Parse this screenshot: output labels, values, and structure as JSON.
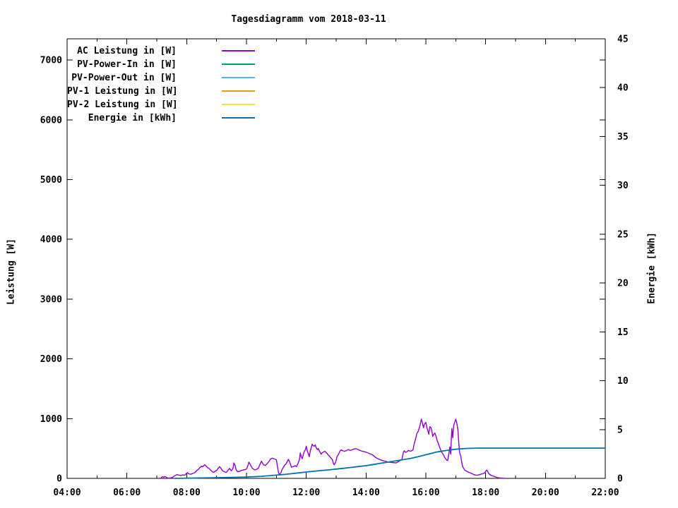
{
  "title": "Tagesdiagramm vom 2018-03-11",
  "chart_data": {
    "type": "line",
    "title": "Tagesdiagramm vom 2018-03-11",
    "grid": false,
    "legend_position": "top-left-inside",
    "background_color": "#ffffff",
    "border_color": "#000000",
    "x_axis": {
      "label": "",
      "range_hours": [
        4,
        22
      ],
      "major_tick_hours": [
        4,
        6,
        8,
        10,
        12,
        14,
        16,
        18,
        20,
        22
      ],
      "major_tick_labels": [
        "04:00",
        "06:00",
        "08:00",
        "10:00",
        "12:00",
        "14:00",
        "16:00",
        "18:00",
        "20:00",
        "22:00"
      ],
      "minor_tick_hours": [
        5,
        7,
        9,
        11,
        13,
        15,
        17,
        19,
        21
      ]
    },
    "y_left": {
      "label": "Leistung [W]",
      "range": [
        0,
        7355
      ],
      "tick_values": [
        0,
        1000,
        2000,
        3000,
        4000,
        5000,
        6000,
        7000
      ],
      "tick_labels": [
        "0",
        "1000",
        "2000",
        "3000",
        "4000",
        "5000",
        "6000",
        "7000"
      ]
    },
    "y_right": {
      "label": "Energie [kWh]",
      "range": [
        0,
        45
      ],
      "tick_values": [
        0,
        5,
        10,
        15,
        20,
        25,
        30,
        35,
        40,
        45
      ],
      "tick_labels": [
        "0",
        "5",
        "10",
        "15",
        "20",
        "25",
        "30",
        "35",
        "40",
        "45"
      ]
    },
    "series": [
      {
        "name": "AC Leistung in [W]",
        "color": "#9400d3",
        "axis": "left",
        "stroke_width": 1.4,
        "points": [
          [
            7.13,
            0
          ],
          [
            7.17,
            22
          ],
          [
            7.2,
            30
          ],
          [
            7.23,
            18
          ],
          [
            7.27,
            32
          ],
          [
            7.3,
            25
          ],
          [
            7.33,
            12
          ],
          [
            7.4,
            4
          ],
          [
            7.47,
            8
          ],
          [
            7.53,
            18
          ],
          [
            7.6,
            45
          ],
          [
            7.67,
            62
          ],
          [
            7.73,
            55
          ],
          [
            7.8,
            48
          ],
          [
            7.87,
            58
          ],
          [
            7.93,
            52
          ],
          [
            8.0,
            85
          ],
          [
            8.03,
            95
          ],
          [
            8.07,
            75
          ],
          [
            8.13,
            68
          ],
          [
            8.2,
            82
          ],
          [
            8.27,
            95
          ],
          [
            8.33,
            130
          ],
          [
            8.4,
            155
          ],
          [
            8.43,
            175
          ],
          [
            8.47,
            190
          ],
          [
            8.5,
            205
          ],
          [
            8.53,
            192
          ],
          [
            8.57,
            210
          ],
          [
            8.6,
            228
          ],
          [
            8.63,
            215
          ],
          [
            8.67,
            195
          ],
          [
            8.7,
            178
          ],
          [
            8.75,
            165
          ],
          [
            8.8,
            140
          ],
          [
            8.85,
            112
          ],
          [
            8.9,
            100
          ],
          [
            8.95,
            118
          ],
          [
            9.0,
            132
          ],
          [
            9.05,
            165
          ],
          [
            9.1,
            195
          ],
          [
            9.13,
            178
          ],
          [
            9.17,
            150
          ],
          [
            9.2,
            128
          ],
          [
            9.27,
            108
          ],
          [
            9.33,
            102
          ],
          [
            9.4,
            145
          ],
          [
            9.43,
            168
          ],
          [
            9.47,
            140
          ],
          [
            9.5,
            128
          ],
          [
            9.55,
            172
          ],
          [
            9.58,
            258
          ],
          [
            9.62,
            215
          ],
          [
            9.65,
            148
          ],
          [
            9.7,
            112
          ],
          [
            9.77,
            118
          ],
          [
            9.83,
            132
          ],
          [
            9.9,
            142
          ],
          [
            9.97,
            148
          ],
          [
            10.0,
            158
          ],
          [
            10.05,
            215
          ],
          [
            10.08,
            272
          ],
          [
            10.12,
            240
          ],
          [
            10.15,
            205
          ],
          [
            10.2,
            168
          ],
          [
            10.27,
            142
          ],
          [
            10.33,
            148
          ],
          [
            10.4,
            172
          ],
          [
            10.45,
            230
          ],
          [
            10.5,
            288
          ],
          [
            10.53,
            262
          ],
          [
            10.57,
            228
          ],
          [
            10.63,
            215
          ],
          [
            10.7,
            252
          ],
          [
            10.75,
            282
          ],
          [
            10.8,
            322
          ],
          [
            10.87,
            338
          ],
          [
            10.93,
            325
          ],
          [
            11.0,
            312
          ],
          [
            11.03,
            220
          ],
          [
            11.07,
            95
          ],
          [
            11.1,
            68
          ],
          [
            11.15,
            92
          ],
          [
            11.2,
            158
          ],
          [
            11.27,
            215
          ],
          [
            11.33,
            248
          ],
          [
            11.4,
            318
          ],
          [
            11.43,
            288
          ],
          [
            11.47,
            242
          ],
          [
            11.5,
            188
          ],
          [
            11.57,
            198
          ],
          [
            11.63,
            212
          ],
          [
            11.67,
            195
          ],
          [
            11.72,
            248
          ],
          [
            11.77,
            308
          ],
          [
            11.8,
            425
          ],
          [
            11.83,
            358
          ],
          [
            11.87,
            332
          ],
          [
            11.9,
            398
          ],
          [
            11.93,
            445
          ],
          [
            11.97,
            478
          ],
          [
            12.0,
            540
          ],
          [
            12.03,
            468
          ],
          [
            12.07,
            412
          ],
          [
            12.1,
            362
          ],
          [
            12.13,
            448
          ],
          [
            12.17,
            525
          ],
          [
            12.2,
            572
          ],
          [
            12.23,
            548
          ],
          [
            12.27,
            538
          ],
          [
            12.3,
            562
          ],
          [
            12.33,
            515
          ],
          [
            12.37,
            482
          ],
          [
            12.4,
            502
          ],
          [
            12.43,
            465
          ],
          [
            12.47,
            428
          ],
          [
            12.5,
            405
          ],
          [
            12.53,
            428
          ],
          [
            12.57,
            440
          ],
          [
            12.6,
            448
          ],
          [
            12.63,
            452
          ],
          [
            12.67,
            428
          ],
          [
            12.7,
            415
          ],
          [
            12.73,
            392
          ],
          [
            12.77,
            378
          ],
          [
            12.8,
            355
          ],
          [
            12.83,
            338
          ],
          [
            12.87,
            318
          ],
          [
            12.9,
            262
          ],
          [
            12.93,
            228
          ],
          [
            12.97,
            258
          ],
          [
            13.0,
            305
          ],
          [
            13.03,
            368
          ],
          [
            13.07,
            398
          ],
          [
            13.1,
            425
          ],
          [
            13.13,
            458
          ],
          [
            13.17,
            478
          ],
          [
            13.2,
            468
          ],
          [
            13.27,
            452
          ],
          [
            13.33,
            462
          ],
          [
            13.4,
            482
          ],
          [
            13.47,
            468
          ],
          [
            13.53,
            478
          ],
          [
            13.6,
            492
          ],
          [
            13.67,
            498
          ],
          [
            13.73,
            482
          ],
          [
            13.8,
            468
          ],
          [
            13.87,
            455
          ],
          [
            13.93,
            448
          ],
          [
            14.0,
            438
          ],
          [
            14.07,
            425
          ],
          [
            14.13,
            412
          ],
          [
            14.2,
            398
          ],
          [
            14.27,
            372
          ],
          [
            14.33,
            345
          ],
          [
            14.4,
            328
          ],
          [
            14.47,
            312
          ],
          [
            14.53,
            302
          ],
          [
            14.6,
            292
          ],
          [
            14.67,
            282
          ],
          [
            14.73,
            275
          ],
          [
            14.8,
            268
          ],
          [
            14.87,
            265
          ],
          [
            14.93,
            262
          ],
          [
            15.0,
            258
          ],
          [
            15.05,
            272
          ],
          [
            15.1,
            288
          ],
          [
            15.15,
            302
          ],
          [
            15.2,
            318
          ],
          [
            15.25,
            442
          ],
          [
            15.28,
            462
          ],
          [
            15.32,
            435
          ],
          [
            15.37,
            448
          ],
          [
            15.42,
            468
          ],
          [
            15.47,
            455
          ],
          [
            15.52,
            462
          ],
          [
            15.57,
            478
          ],
          [
            15.6,
            558
          ],
          [
            15.65,
            648
          ],
          [
            15.7,
            752
          ],
          [
            15.75,
            795
          ],
          [
            15.8,
            875
          ],
          [
            15.85,
            992
          ],
          [
            15.88,
            935
          ],
          [
            15.92,
            848
          ],
          [
            15.95,
            905
          ],
          [
            16.0,
            938
          ],
          [
            16.03,
            855
          ],
          [
            16.07,
            792
          ],
          [
            16.1,
            738
          ],
          [
            16.13,
            865
          ],
          [
            16.17,
            848
          ],
          [
            16.2,
            795
          ],
          [
            16.23,
            702
          ],
          [
            16.27,
            742
          ],
          [
            16.3,
            758
          ],
          [
            16.33,
            722
          ],
          [
            16.37,
            645
          ],
          [
            16.4,
            608
          ],
          [
            16.43,
            562
          ],
          [
            16.47,
            508
          ],
          [
            16.5,
            468
          ],
          [
            16.53,
            438
          ],
          [
            16.57,
            408
          ],
          [
            16.6,
            382
          ],
          [
            16.63,
            348
          ],
          [
            16.67,
            322
          ],
          [
            16.7,
            305
          ],
          [
            16.73,
            298
          ],
          [
            16.77,
            418
          ],
          [
            16.8,
            525
          ],
          [
            16.83,
            405
          ],
          [
            16.87,
            832
          ],
          [
            16.9,
            678
          ],
          [
            16.93,
            885
          ],
          [
            16.97,
            948
          ],
          [
            17.0,
            992
          ],
          [
            17.03,
            938
          ],
          [
            17.07,
            825
          ],
          [
            17.1,
            592
          ],
          [
            17.13,
            432
          ],
          [
            17.17,
            368
          ],
          [
            17.2,
            268
          ],
          [
            17.23,
            198
          ],
          [
            17.27,
            162
          ],
          [
            17.3,
            138
          ],
          [
            17.37,
            118
          ],
          [
            17.43,
            102
          ],
          [
            17.5,
            88
          ],
          [
            17.57,
            72
          ],
          [
            17.63,
            58
          ],
          [
            17.7,
            52
          ],
          [
            17.77,
            58
          ],
          [
            17.83,
            68
          ],
          [
            17.9,
            78
          ],
          [
            17.97,
            92
          ],
          [
            18.03,
            138
          ],
          [
            18.07,
            118
          ],
          [
            18.1,
            82
          ],
          [
            18.17,
            52
          ],
          [
            18.23,
            42
          ],
          [
            18.3,
            28
          ],
          [
            18.37,
            18
          ],
          [
            18.43,
            10
          ],
          [
            18.5,
            6
          ],
          [
            18.6,
            2
          ],
          [
            18.65,
            0
          ]
        ]
      },
      {
        "name": "PV-Power-In in [W]",
        "color": "#009e73",
        "axis": "left",
        "stroke_width": 1.4,
        "points": []
      },
      {
        "name": "PV-Power-Out in [W]",
        "color": "#56b4e9",
        "axis": "left",
        "stroke_width": 1.4,
        "points": []
      },
      {
        "name": "PV-1 Leistung in [W]",
        "color": "#e69f00",
        "axis": "left",
        "stroke_width": 1.4,
        "points": []
      },
      {
        "name": "PV-2 Leistung in [W]",
        "color": "#f0e442",
        "axis": "left",
        "stroke_width": 1.4,
        "points": []
      },
      {
        "name": "Energie in [kWh]",
        "color": "#0072b2",
        "axis": "right",
        "stroke_width": 1.8,
        "points": [
          [
            7.6,
            0
          ],
          [
            8.0,
            0.02
          ],
          [
            8.5,
            0.04
          ],
          [
            9.0,
            0.07
          ],
          [
            9.5,
            0.1
          ],
          [
            10.0,
            0.14
          ],
          [
            10.5,
            0.21
          ],
          [
            11.0,
            0.33
          ],
          [
            11.25,
            0.4
          ],
          [
            11.5,
            0.48
          ],
          [
            11.75,
            0.56
          ],
          [
            12.0,
            0.65
          ],
          [
            12.25,
            0.73
          ],
          [
            12.5,
            0.8
          ],
          [
            12.75,
            0.87
          ],
          [
            13.0,
            0.95
          ],
          [
            13.25,
            1.03
          ],
          [
            13.5,
            1.12
          ],
          [
            13.75,
            1.21
          ],
          [
            14.0,
            1.3
          ],
          [
            14.25,
            1.42
          ],
          [
            14.5,
            1.55
          ],
          [
            14.75,
            1.67
          ],
          [
            15.0,
            1.8
          ],
          [
            15.25,
            1.92
          ],
          [
            15.5,
            2.05
          ],
          [
            15.75,
            2.22
          ],
          [
            16.0,
            2.42
          ],
          [
            16.17,
            2.55
          ],
          [
            16.33,
            2.68
          ],
          [
            16.5,
            2.77
          ],
          [
            16.67,
            2.85
          ],
          [
            16.83,
            2.92
          ],
          [
            17.0,
            2.98
          ],
          [
            17.17,
            3.03
          ],
          [
            17.33,
            3.06
          ],
          [
            17.5,
            3.08
          ],
          [
            17.75,
            3.1
          ],
          [
            18.0,
            3.1
          ],
          [
            22.0,
            3.1
          ]
        ]
      }
    ]
  }
}
